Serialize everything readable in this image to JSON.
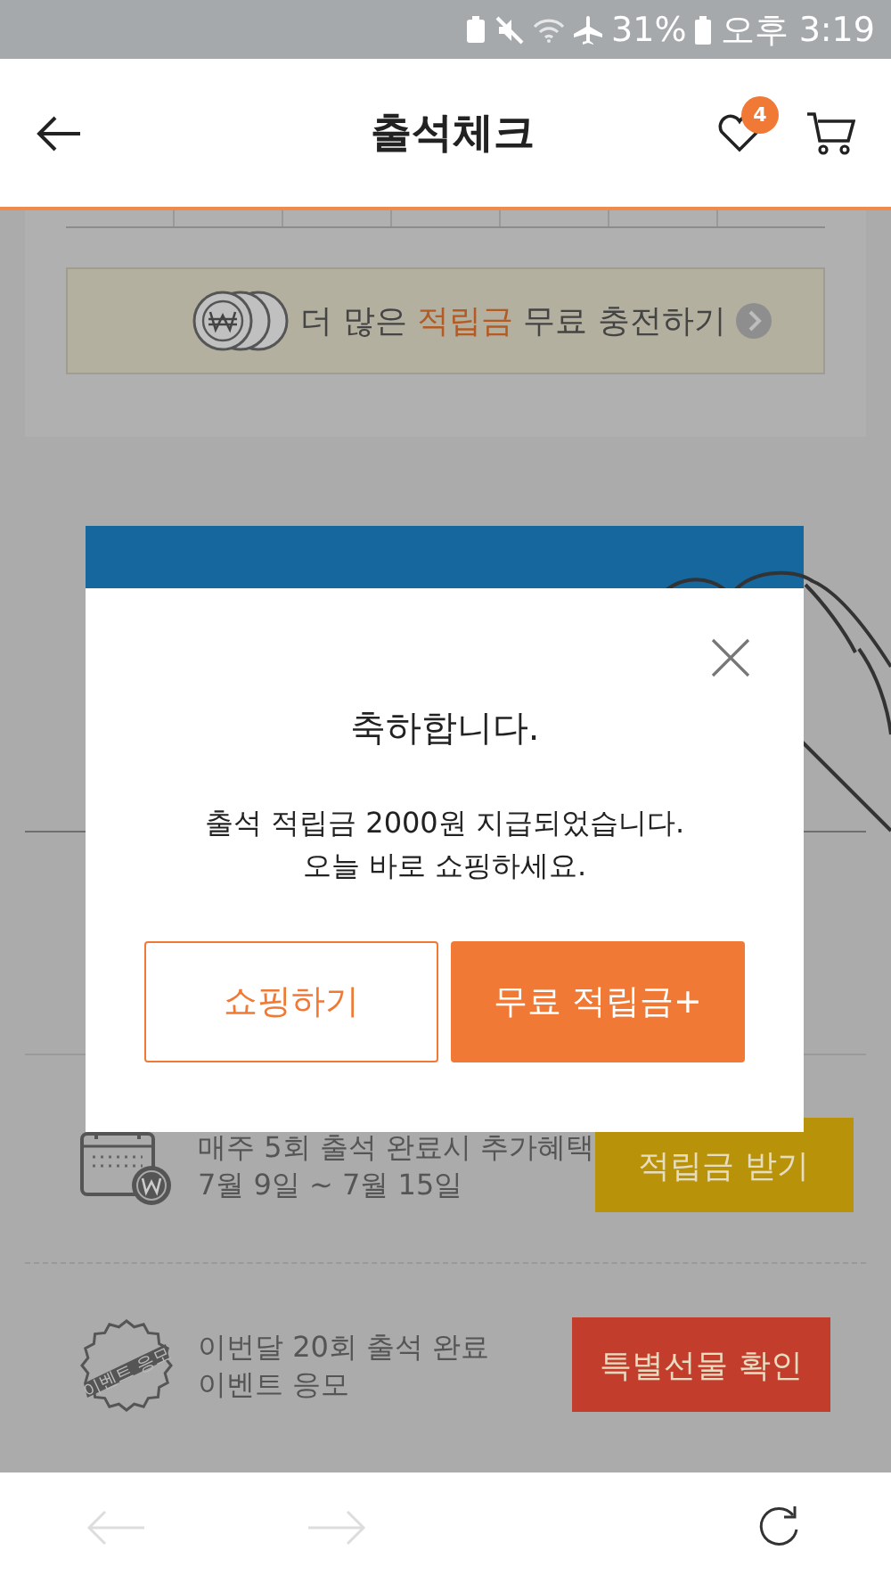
{
  "status_bar": {
    "battery": "31%",
    "time": "오후 3:19"
  },
  "header": {
    "title": "출석체크",
    "wishlist_badge": "4"
  },
  "banner": {
    "text": "더 많은 **적립금** 무료 충전하기"
  },
  "benefits": [
    {
      "kind": "calendar",
      "lines": [
        "매주 5회 출석 완료시 추가혜택",
        "7월 9일 ~ 7월 15일"
      ],
      "button": "적립금 받기",
      "color": "#b8930a"
    },
    {
      "kind": "stamp",
      "stamp_label": "이벤트 응모",
      "lines": [
        "이번달 20회 출석 완료",
        "이벤트 응모"
      ],
      "button": "특별선물 확인",
      "color": "#c23d2c"
    }
  ],
  "modal": {
    "title": "축하합니다.",
    "message_lines": [
      "출석 적립금 2000원 지급되었습니다.",
      "오늘 바로 쇼핑하세요."
    ],
    "buttons": [
      {
        "kind": "outline",
        "label": "쇼핑하기"
      },
      {
        "kind": "filled",
        "label": "무료 적립금+"
      }
    ]
  },
  "bottom_nav": {
    "back": {
      "disabled": true
    },
    "forward": {
      "disabled": true
    }
  }
}
